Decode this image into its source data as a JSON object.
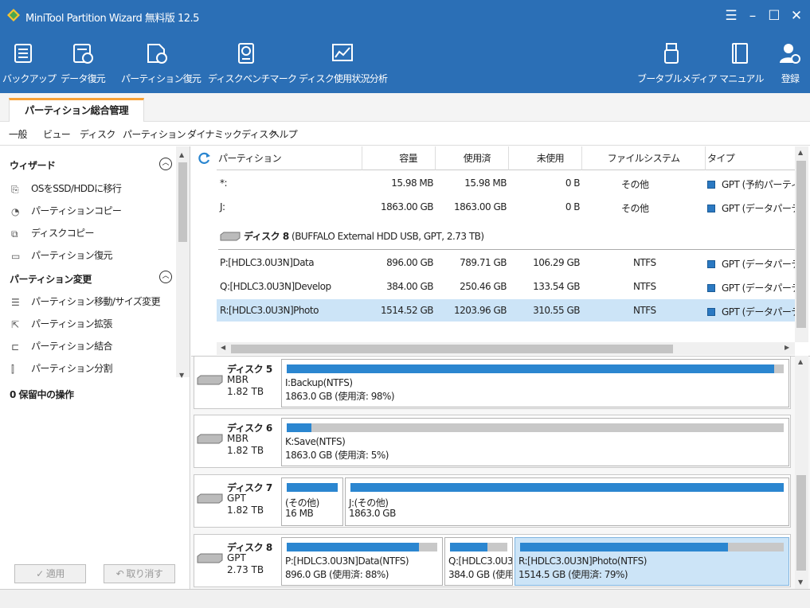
{
  "window": {
    "title": "MiniTool Partition Wizard 無料版 12.5"
  },
  "toolbar": {
    "backup": "バックアップ",
    "data_recovery": "データ復元",
    "partition_recovery": "パーティション復元",
    "disk_benchmark": "ディスクベンチマーク",
    "space_analyzer": "ディスク使用状況分析",
    "bootable_media": "ブータブルメディア",
    "manual": "マニュアル",
    "register": "登録"
  },
  "tab": {
    "label": "パーティション総合管理"
  },
  "menu": [
    "一般",
    "ビュー",
    "ディスク",
    "パーティション",
    "ダイナミックディスク",
    "ヘルプ"
  ],
  "sidebar": {
    "wizard_title": "ウィザード",
    "wizard_items": [
      "OSをSSD/HDDに移行",
      "パーティションコピー",
      "ディスクコピー",
      "パーティション復元"
    ],
    "change_title": "パーティション変更",
    "change_items": [
      "パーティション移動/サイズ変更",
      "パーティション拡張",
      "パーティション結合",
      "パーティション分割"
    ],
    "pending": "0 保留中の操作",
    "apply": "✓ 適用",
    "undo": "↶ 取り消す"
  },
  "table": {
    "headers": [
      "パーティション",
      "容量",
      "使用済",
      "未使用",
      "ファイルシステム",
      "タイプ"
    ],
    "rows": [
      {
        "name": "*:",
        "capacity": "15.98 MB",
        "used": "15.98 MB",
        "unused": "0 B",
        "fs": "その他",
        "type": "GPT (予約パーティ"
      },
      {
        "name": "J:",
        "capacity": "1863.00 GB",
        "used": "1863.00 GB",
        "unused": "0 B",
        "fs": "その他",
        "type": "GPT (データパーテ"
      },
      {
        "name": "P:[HDLC3.0U3N]Data",
        "capacity": "896.00 GB",
        "used": "789.71 GB",
        "unused": "106.29 GB",
        "fs": "NTFS",
        "type": "GPT (データパーテ"
      },
      {
        "name": "Q:[HDLC3.0U3N]Develop",
        "capacity": "384.00 GB",
        "used": "250.46 GB",
        "unused": "133.54 GB",
        "fs": "NTFS",
        "type": "GPT (データパーテ"
      },
      {
        "name": "R:[HDLC3.0U3N]Photo",
        "capacity": "1514.52 GB",
        "used": "1203.96 GB",
        "unused": "310.55 GB",
        "fs": "NTFS",
        "type": "GPT (データパーテ"
      }
    ],
    "disk8_header_bold": "ディスク 8",
    "disk8_header_rest": " (BUFFALO External HDD USB, GPT, 2.73 TB)"
  },
  "disks": [
    {
      "name": "ディスク 5",
      "type": "MBR",
      "size": "1.82 TB",
      "parts": [
        {
          "label": "I:Backup(NTFS)",
          "detail": "1863.0 GB (使用済: 98%)",
          "used_fraction": 0.98
        }
      ]
    },
    {
      "name": "ディスク 6",
      "type": "MBR",
      "size": "1.82 TB",
      "parts": [
        {
          "label": "K:Save(NTFS)",
          "detail": "1863.0 GB (使用済: 5%)",
          "used_fraction": 0.05
        }
      ]
    },
    {
      "name": "ディスク 7",
      "type": "GPT",
      "size": "1.82 TB",
      "parts": [
        {
          "label": "(その他)",
          "detail": "16 MB",
          "used_fraction": 1.0
        },
        {
          "label": "J:(その他)",
          "detail": "1863.0 GB",
          "used_fraction": 1.0
        }
      ]
    },
    {
      "name": "ディスク 8",
      "type": "GPT",
      "size": "2.73 TB",
      "parts": [
        {
          "label": "P:[HDLC3.0U3N]Data(NTFS)",
          "detail": "896.0 GB (使用済: 88%)",
          "used_fraction": 0.88
        },
        {
          "label": "Q:[HDLC3.0U3",
          "detail": "384.0 GB (使用",
          "used_fraction": 0.65
        },
        {
          "label": "R:[HDLC3.0U3N]Photo(NTFS)",
          "detail": "1514.5 GB (使用済: 79%)",
          "used_fraction": 0.79
        }
      ]
    }
  ],
  "colors": {
    "accent": "#2b6fb6",
    "bar_fill": "#2b86d0",
    "selection": "#cce4f7",
    "tab_accent": "#f7a136"
  }
}
